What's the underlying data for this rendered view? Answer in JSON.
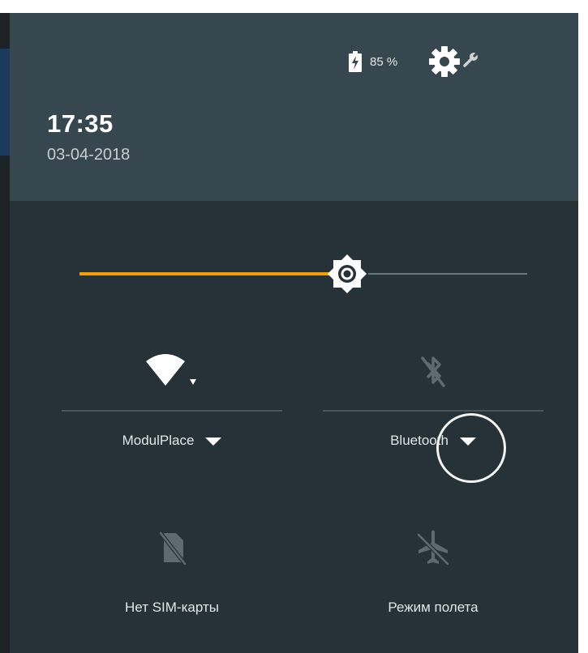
{
  "header": {
    "battery_text": "85 %",
    "time": "17:35",
    "date": "03-04-2018"
  },
  "brightness": {
    "level": 0.597
  },
  "tiles": {
    "wifi": {
      "label": "ModulPlace",
      "icon": "wifi-icon"
    },
    "bluetooth": {
      "label": "Bluetooth",
      "icon": "bluetooth-off-icon"
    },
    "sim": {
      "label": "Нет SIM-карты",
      "icon": "no-sim-icon"
    },
    "airplane": {
      "label": "Режим полета",
      "icon": "airplane-mode-off-icon"
    }
  },
  "colors": {
    "panel": "#263238",
    "header": "#37474f",
    "accent": "#f5a000",
    "icon_active": "#ffffff",
    "icon_inactive": "#5f6a70"
  }
}
